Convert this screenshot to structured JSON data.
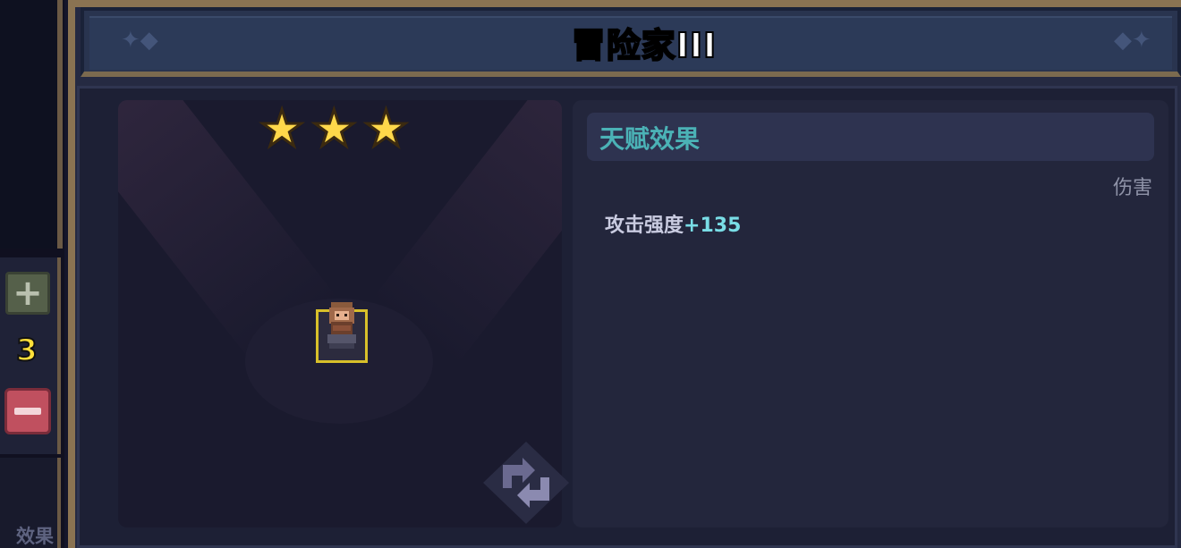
{
  "title": "冒险家III",
  "sidebar": {
    "count": "3",
    "bottom_label": "效果"
  },
  "preview": {
    "stars": 3
  },
  "talent": {
    "header": "天赋效果",
    "tag": "伤害",
    "stat_name": "攻击强度",
    "stat_value": "+135"
  },
  "colors": {
    "accent_teal": "#4bb2b6",
    "value_cyan": "#79dde6",
    "star_gold": "#ffd84a",
    "count_yellow": "#ffe03a",
    "minus_red": "#c0505f"
  }
}
